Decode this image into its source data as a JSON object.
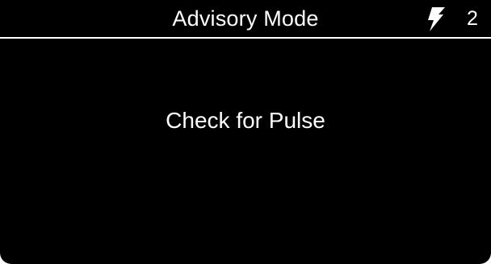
{
  "header": {
    "title": "Advisory Mode",
    "shock_icon": "lightning-bolt-icon",
    "shock_count": "2"
  },
  "main": {
    "message": "Check for Pulse"
  },
  "colors": {
    "background": "#000000",
    "foreground": "#ffffff"
  }
}
